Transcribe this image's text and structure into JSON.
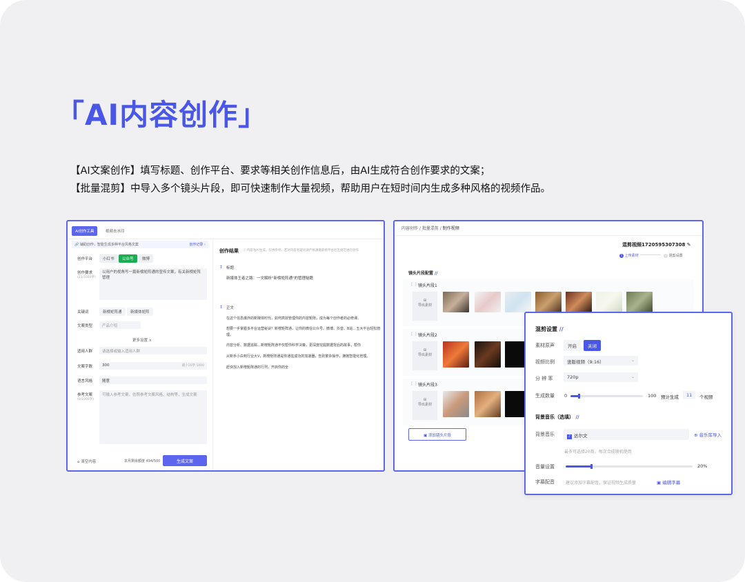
{
  "headline": "「AI内容创作」",
  "description": [
    "【AI文案创作】填写标题、创作平台、要求等相关创作信息后，由AI生成符合创作要求的文案；",
    "【批量混剪】中导入多个镜头片段，即可快速制作大量视频，帮助用户在短时间内生成多种风格的视频作品。"
  ],
  "left": {
    "tabs": [
      "AI创作工具",
      "视频去水印"
    ],
    "hint": "🔗 辅助创作，智能生成多种平台风格文案",
    "history_link": "创作记录 ›",
    "platform_label": "创作平台",
    "platforms": [
      "小红书",
      "公众号",
      "微博"
    ],
    "requirement_label": "创作要求",
    "requirement_count": "(23/1000字)",
    "requirement_text": "以用户的视角写一篇新榜矩阵通的宣传文案，有关新榜矩阵管理",
    "keywords_label": "关键词",
    "keywords": [
      "新榜矩阵通",
      "新媒体矩阵"
    ],
    "doctype_label": "文案类型",
    "doctype_value": "产品介绍",
    "more_settings": "更多设置 ∧",
    "persona_label": "适用人群",
    "persona_placeholder": "请选择或输入适用人群",
    "wordcount_label": "文案字数",
    "wordcount_value": "300",
    "wordcount_hint": "最少20字 5000",
    "style_label": "语言风格",
    "style_value": "随意",
    "reference_label": "参考文案",
    "reference_count": "(0/1000字)",
    "reference_placeholder": "可输入参考文案，仿照参考文案风格、结构等，生成文案",
    "clear_button": "清空内容",
    "remaining": "本月剩余额度 494/500",
    "generate_button": "生成文案",
    "result_title": "创作结果",
    "result_hint": "ⓘ 内容为AI生成，仅供参考，若对内容有疑问请严格遵循新榜平台社区规范进行创作",
    "result_title_section": "标题",
    "result_title_text": "新媒体王者之路：一文解析\"新榜矩阵通\"的管理秘籍",
    "result_body_section": "正文",
    "result_body": [
      "在这个信息爆炸的新媒体时代，如何高效管理你的内容矩阵，成为每个创作者的必修课。",
      "想要一手掌握多平台运营秘诀？新榜矩阵通，让你的微信公众号、微博、抖音、B站…五大平台轻松管",
      "理。",
      "内容分析、数据追踪…新榜矩阵通不仅帮你科学决策，更深度挖掘数据背后的故事，帮你",
      "从新手小白到行业大V，新榜矩阵通是你通往成功的加速器，告别繁杂操作，拥抱智能化管理。",
      "赶快加入新榜矩阵通的行列，开启你的全"
    ]
  },
  "right": {
    "breadcrumb": [
      "内容创作",
      "批量混剪",
      "制作视频"
    ],
    "project_name": "混剪视频1720595307308",
    "steps": [
      "上传素材",
      "混剪设置"
    ],
    "config_title": "镜头片段配置",
    "segments": [
      "镜头片段1",
      "镜头片段2",
      "镜头片段3"
    ],
    "import_label": "导出素材",
    "add_segment_button": "添加镜头片段"
  },
  "overlay": {
    "title": "混剪设置",
    "original_sound_label": "素材原声",
    "sound_options": [
      "开启",
      "关闭"
    ],
    "ratio_label": "视频比例",
    "ratio_value": "竖版视频（9:16）",
    "resolution_label": "分 辨 率",
    "resolution_value": "720p",
    "count_label": "生成数量",
    "count_min": "0",
    "count_max": "100",
    "count_prefix": "预计生成",
    "count_value": "11",
    "count_suffix": "个视频",
    "music_title": "背景音乐（选填）",
    "music_label": "背景音乐",
    "music_value": "达尔文",
    "music_import": "音乐库导入",
    "music_hint": "最多可选择20首，每次合成随机使用",
    "volume_label": "音量设置",
    "volume_value": "20%",
    "subtitle_label": "字幕配音",
    "subtitle_hint": "建议添加字幕配音，保证视频生成质量",
    "subtitle_button": "编辑字幕"
  },
  "colors": {
    "accent": "#4a56e6",
    "border": "#5b65ee",
    "green": "#1aad53",
    "background": "#f0f0f2"
  }
}
